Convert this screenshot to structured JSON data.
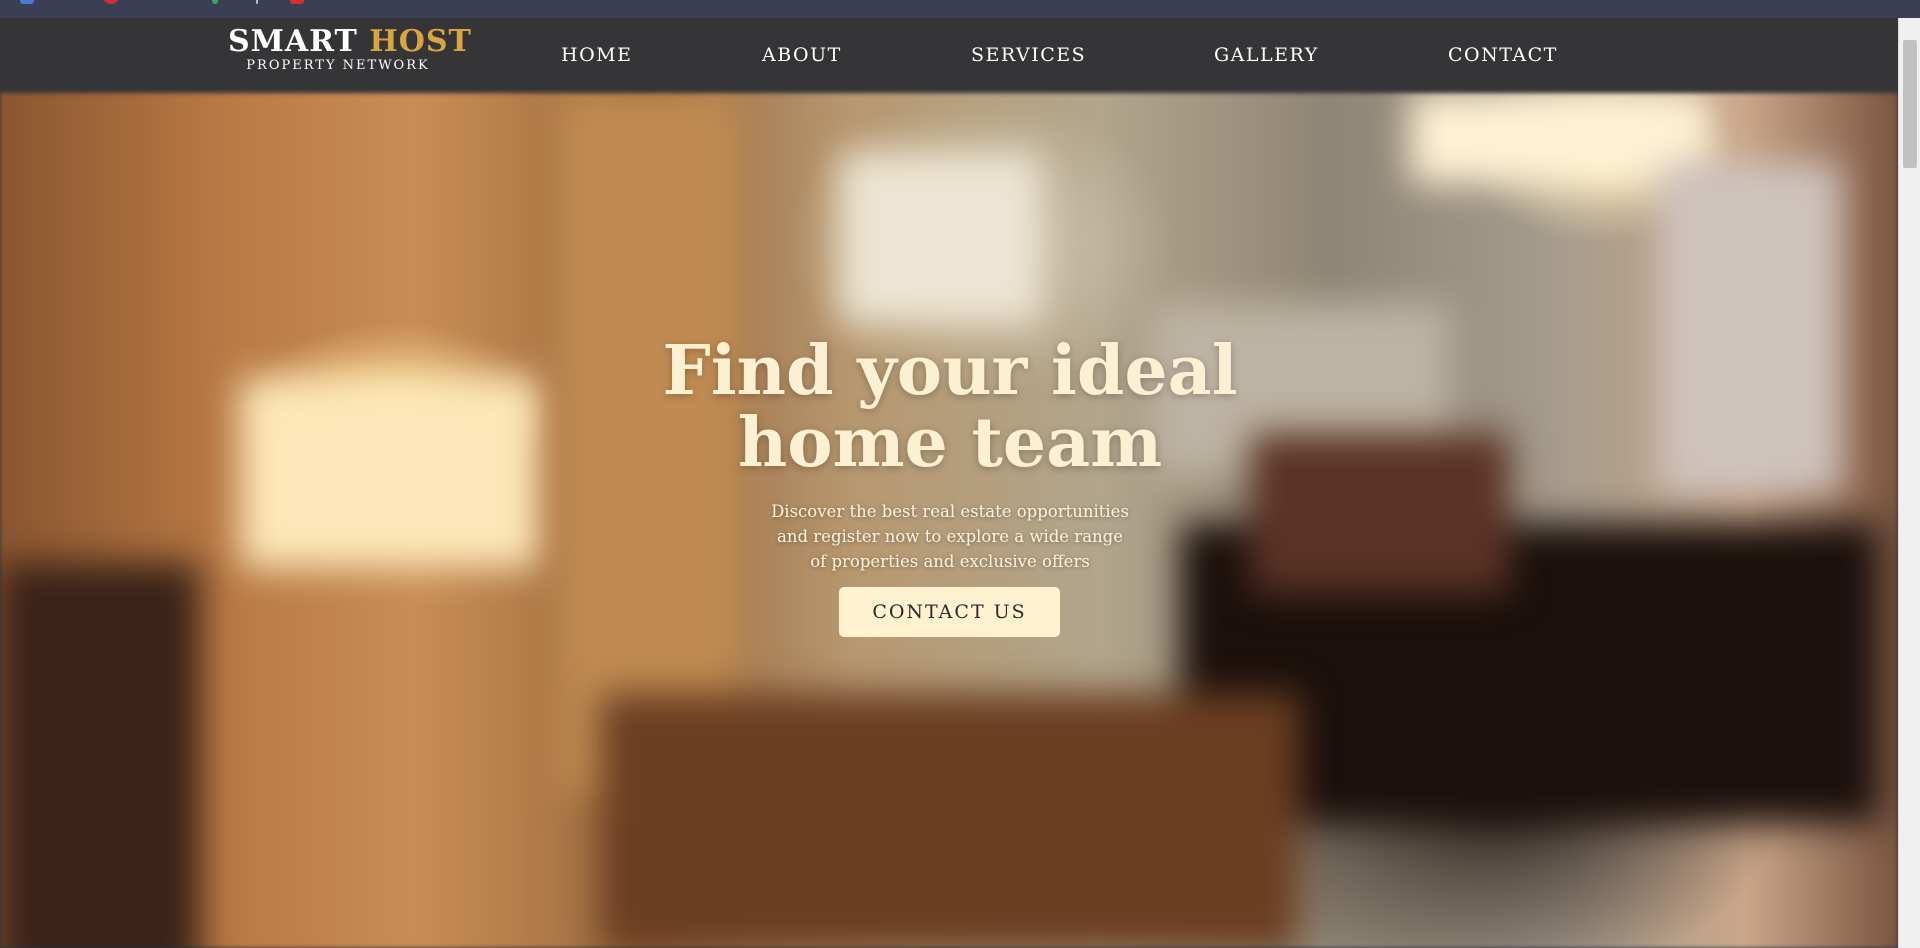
{
  "logo": {
    "word1": "SMART",
    "word2": "HOST",
    "tagline": "PROPERTY NETWORK",
    "accent_color": "#d9a441"
  },
  "nav": {
    "items": [
      {
        "label": "HOME"
      },
      {
        "label": "ABOUT"
      },
      {
        "label": "SERVICES"
      },
      {
        "label": "GALLERY"
      },
      {
        "label": "CONTACT"
      }
    ]
  },
  "hero": {
    "title_line1": "Find your ideal",
    "title_line2": "home team",
    "subtitle": "Discover the best real estate opportunities and register now to explore a wide range of properties and exclusive offers",
    "cta_label": "CONTACT US",
    "background": "blurred-interior-photo"
  },
  "colors": {
    "navbar_bg": "#353538",
    "title_color": "#fbf0d2",
    "cta_bg": "#fdf1d0"
  }
}
